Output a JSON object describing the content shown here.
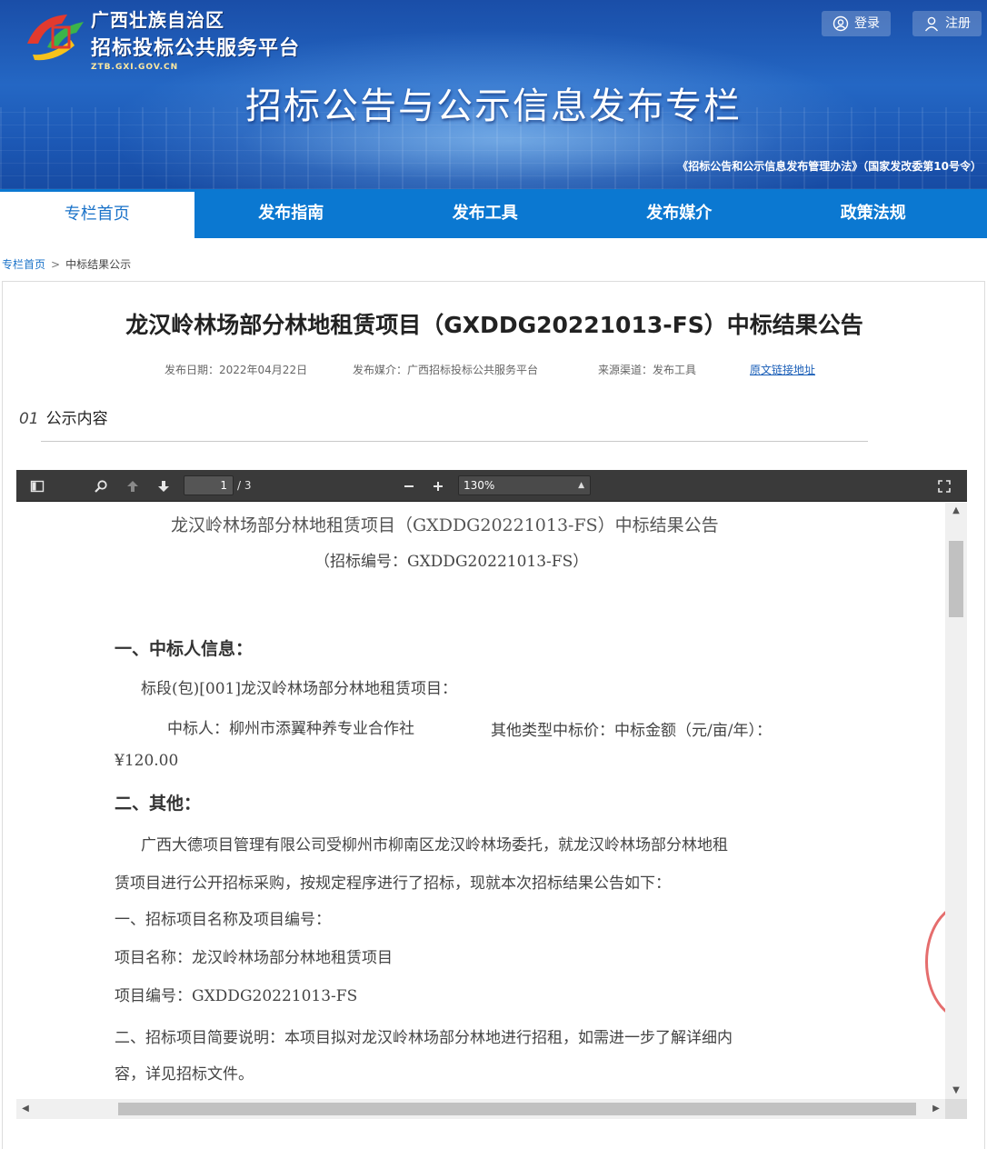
{
  "header": {
    "brand_line1": "广西壮族自治区",
    "brand_line2": "招标投标公共服务平台",
    "brand_domain": "ZTB.GXI.GOV.CN",
    "banner_title": "招标公告与公示信息发布专栏",
    "law_note": "《招标公告和公示信息发布管理办法》（国家发改委第10号令）",
    "login_label": "登录",
    "register_label": "注册"
  },
  "nav": {
    "items": [
      {
        "label": "专栏首页",
        "active": true
      },
      {
        "label": "发布指南",
        "active": false
      },
      {
        "label": "发布工具",
        "active": false
      },
      {
        "label": "发布媒介",
        "active": false
      },
      {
        "label": "政策法规",
        "active": false
      }
    ]
  },
  "breadcrumb": {
    "home": "专栏首页",
    "separator": ">",
    "current": "中标结果公示"
  },
  "article": {
    "title": "龙汉岭林场部分林地租赁项目（GXDDG20221013-FS）中标结果公告",
    "publish_date": "发布日期：2022年04月22日",
    "publish_media": "发布媒介：广西招标投标公共服务平台",
    "source_channel": "来源渠道：发布工具",
    "original_link": "原文链接地址",
    "section_number": "01",
    "section_title": "公示内容"
  },
  "pdf_viewer": {
    "current_page": "1",
    "total_pages": "/ 3",
    "zoom": "130%",
    "icons": [
      "sidebar-toggle-icon",
      "search-icon",
      "previous-page-icon",
      "next-page-icon",
      "zoom-out-icon",
      "zoom-in-icon",
      "fullscreen-icon"
    ]
  },
  "pdf_content": {
    "title": "龙汉岭林场部分林地租赁项目（GXDDG20221013-FS）中标结果公告",
    "bid_number": "（招标编号：GXDDG20221013-FS）",
    "h1": "一、中标人信息：",
    "lot": "标段(包)[001]龙汉岭林场部分林地租赁项目：",
    "winner": "中标人：柳州市添翼种养专业合作社",
    "price_label": "其他类型中标价：中标金额（元/亩/年）：",
    "price_value": "¥120.00",
    "h2": "二、其他：",
    "p1_line1": "广西大德项目管理有限公司受柳州市柳南区龙汉岭林场委托，就龙汉岭林场部分林地租",
    "p1_line2": "赁项目进行公开招标采购，按规定程序进行了招标，现就本次招标结果公告如下：",
    "item1": "一、招标项目名称及项目编号：",
    "project_name": "项目名称：龙汉岭林场部分林地租赁项目",
    "project_code": "项目编号：GXDDG20221013-FS",
    "item2_line1": "二、招标项目简要说明：本项目拟对龙汉岭林场部分林地进行招租，如需进一步了解详细内",
    "item2_line2": "容，详见招标文件。"
  },
  "colors": {
    "banner": "#1f5fbd",
    "nav": "#0b78d1",
    "link": "#1b73c9",
    "toolbar": "#3a3a3a"
  }
}
